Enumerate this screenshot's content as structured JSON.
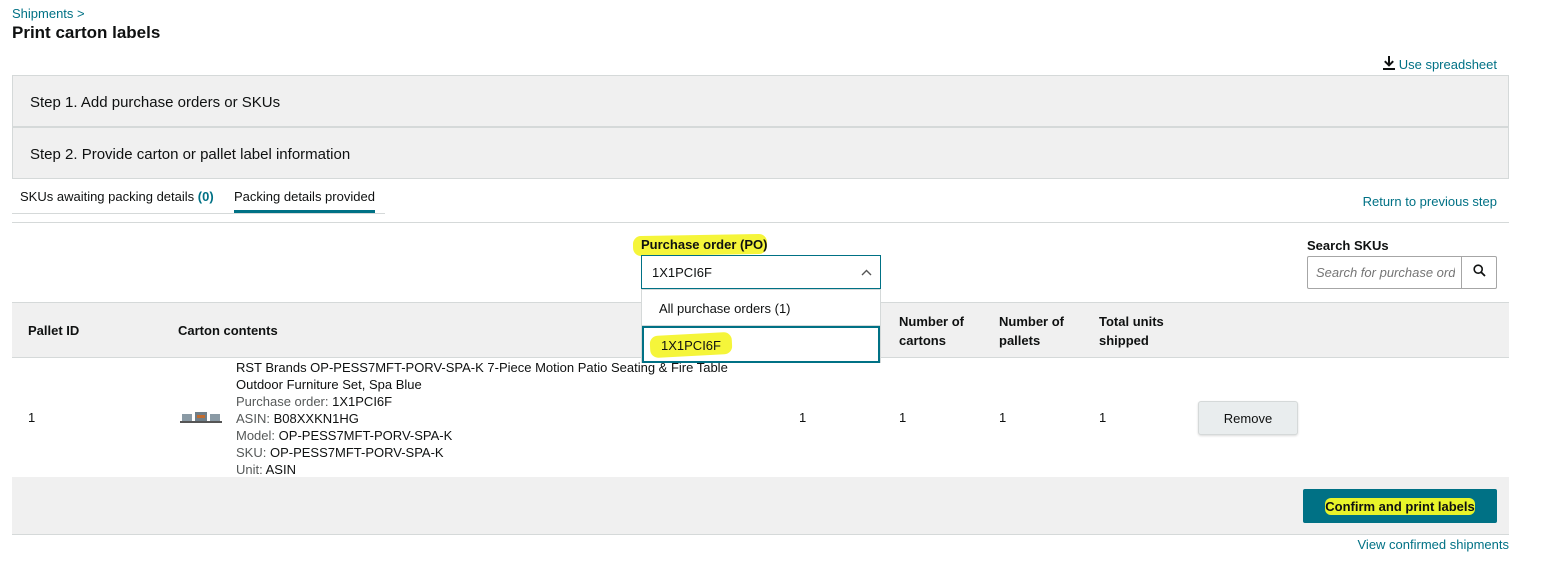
{
  "header": {
    "breadcrumb": "Shipments >",
    "title": "Print carton labels",
    "use_spreadsheet": "Use spreadsheet",
    "icon_download": "download-icon"
  },
  "steps": {
    "step1": "Step 1. Add purchase orders or SKUs",
    "step2": "Step 2. Provide carton or pallet label information"
  },
  "tabs": {
    "tab1_label": "SKUs awaiting packing details",
    "tab1_count": "(0)",
    "tab2_label": "Packing details provided",
    "return_link": "Return to previous step"
  },
  "po_filter": {
    "label": "Purchase order (PO)",
    "selected": "1X1PCI6F",
    "options": [
      "All purchase orders (1)",
      "1X1PCI6F"
    ],
    "icon_chevron": "chevron-up-icon"
  },
  "search": {
    "label": "Search SKUs",
    "placeholder": "Search for purchase orders",
    "icon": "search-icon"
  },
  "table": {
    "headers": {
      "pallet_id": "Pallet ID",
      "carton_contents": "Carton contents",
      "num_cartons_1": "Number of",
      "num_cartons_2": "cartons",
      "num_pallets_1": "Number of",
      "num_pallets_2": "pallets",
      "total_units_1": "Total units",
      "total_units_2": "shipped"
    },
    "rows": [
      {
        "pallet_id": "1",
        "title_line1": "RST Brands OP-PESS7MFT-PORV-SPA-K 7-Piece Motion Patio Seating & Fire Table",
        "title_line2": "Outdoor Furniture Set, Spa Blue",
        "po_key": "Purchase order:",
        "po_val": "1X1PCI6F",
        "asin_key": "ASIN:",
        "asin_val": "B08XXKN1HG",
        "model_key": "Model:",
        "model_val": "OP-PESS7MFT-PORV-SPA-K",
        "sku_key": "SKU:",
        "sku_val": "OP-PESS7MFT-PORV-SPA-K",
        "unit_key": "Unit:",
        "unit_val": "ASIN",
        "units_per_carton": "1",
        "num_cartons": "1",
        "num_pallets": "1",
        "total_units": "1",
        "remove": "Remove"
      }
    ]
  },
  "footer": {
    "confirm": "Confirm and print labels",
    "view_confirmed": "View confirmed shipments"
  },
  "colors": {
    "link": "#007185",
    "panel": "#f0f0f0",
    "highlight": "#f5f53a"
  }
}
